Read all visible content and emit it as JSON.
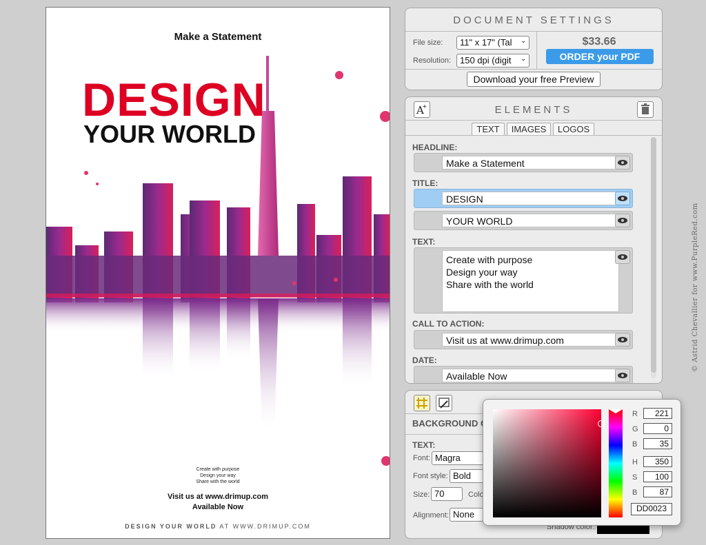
{
  "poster": {
    "headline": "Make a Statement",
    "title_line1": "DESIGN",
    "title_line2": "YOUR WORLD",
    "text_lines": [
      "Create with purpose",
      "Design your way",
      "Share with the world"
    ],
    "call_to_action": "Visit us at www.drimup.com",
    "date": "Available Now",
    "footer_strong": "DESIGN YOUR WORLD",
    "footer_rest": " AT WWW.DRIMUP.COM"
  },
  "document_settings": {
    "title": "DOCUMENT SETTINGS",
    "file_size_label": "File size:",
    "file_size_value": "11\" x 17\" (Tal",
    "resolution_label": "Resolution:",
    "resolution_value": "150 dpi (digit",
    "price": "$33.66",
    "order_label": "ORDER your PDF",
    "preview_label": "Download your free Preview"
  },
  "elements": {
    "title": "ELEMENTS",
    "tabs": [
      "TEXT",
      "IMAGES",
      "LOGOS"
    ],
    "headline_label": "HEADLINE:",
    "headline_value": "Make a Statement",
    "title_label": "TITLE:",
    "title_value1": "DESIGN",
    "title_value2": "YOUR WORLD",
    "text_label": "TEXT:",
    "text_lines": [
      "Create with purpose",
      "Design your way",
      "Share with the world"
    ],
    "cta_label": "CALL TO ACTION:",
    "cta_value": "Visit us at www.drimup.com",
    "date_label": "DATE:",
    "date_value": "Available Now"
  },
  "style_panel": {
    "background_label": "BACKGROUND C",
    "text_label": "TEXT:",
    "font_label": "Font:",
    "font_value": "Magra",
    "font_style_label": "Font style:",
    "font_style_value": "Bold",
    "size_label": "Size:",
    "size_value": "70",
    "color_label": "Colo",
    "alignment_label": "Alignment:",
    "alignment_value": "None",
    "shadow_label": "Shadow color:"
  },
  "color_picker": {
    "R": "221",
    "G": "0",
    "B": "35",
    "H": "350",
    "S": "100",
    "Bv": "87",
    "hex": "DD0023",
    "labels": {
      "R": "R",
      "G": "G",
      "B": "B",
      "H": "H",
      "S": "S",
      "Bv": "B"
    }
  },
  "colors": {
    "accent_red": "#dd0023",
    "order_button": "#3b9be8",
    "active_row": "#9fcdf3"
  },
  "copyright": "© Astrid Chevallier for www.PurpleRed.com"
}
